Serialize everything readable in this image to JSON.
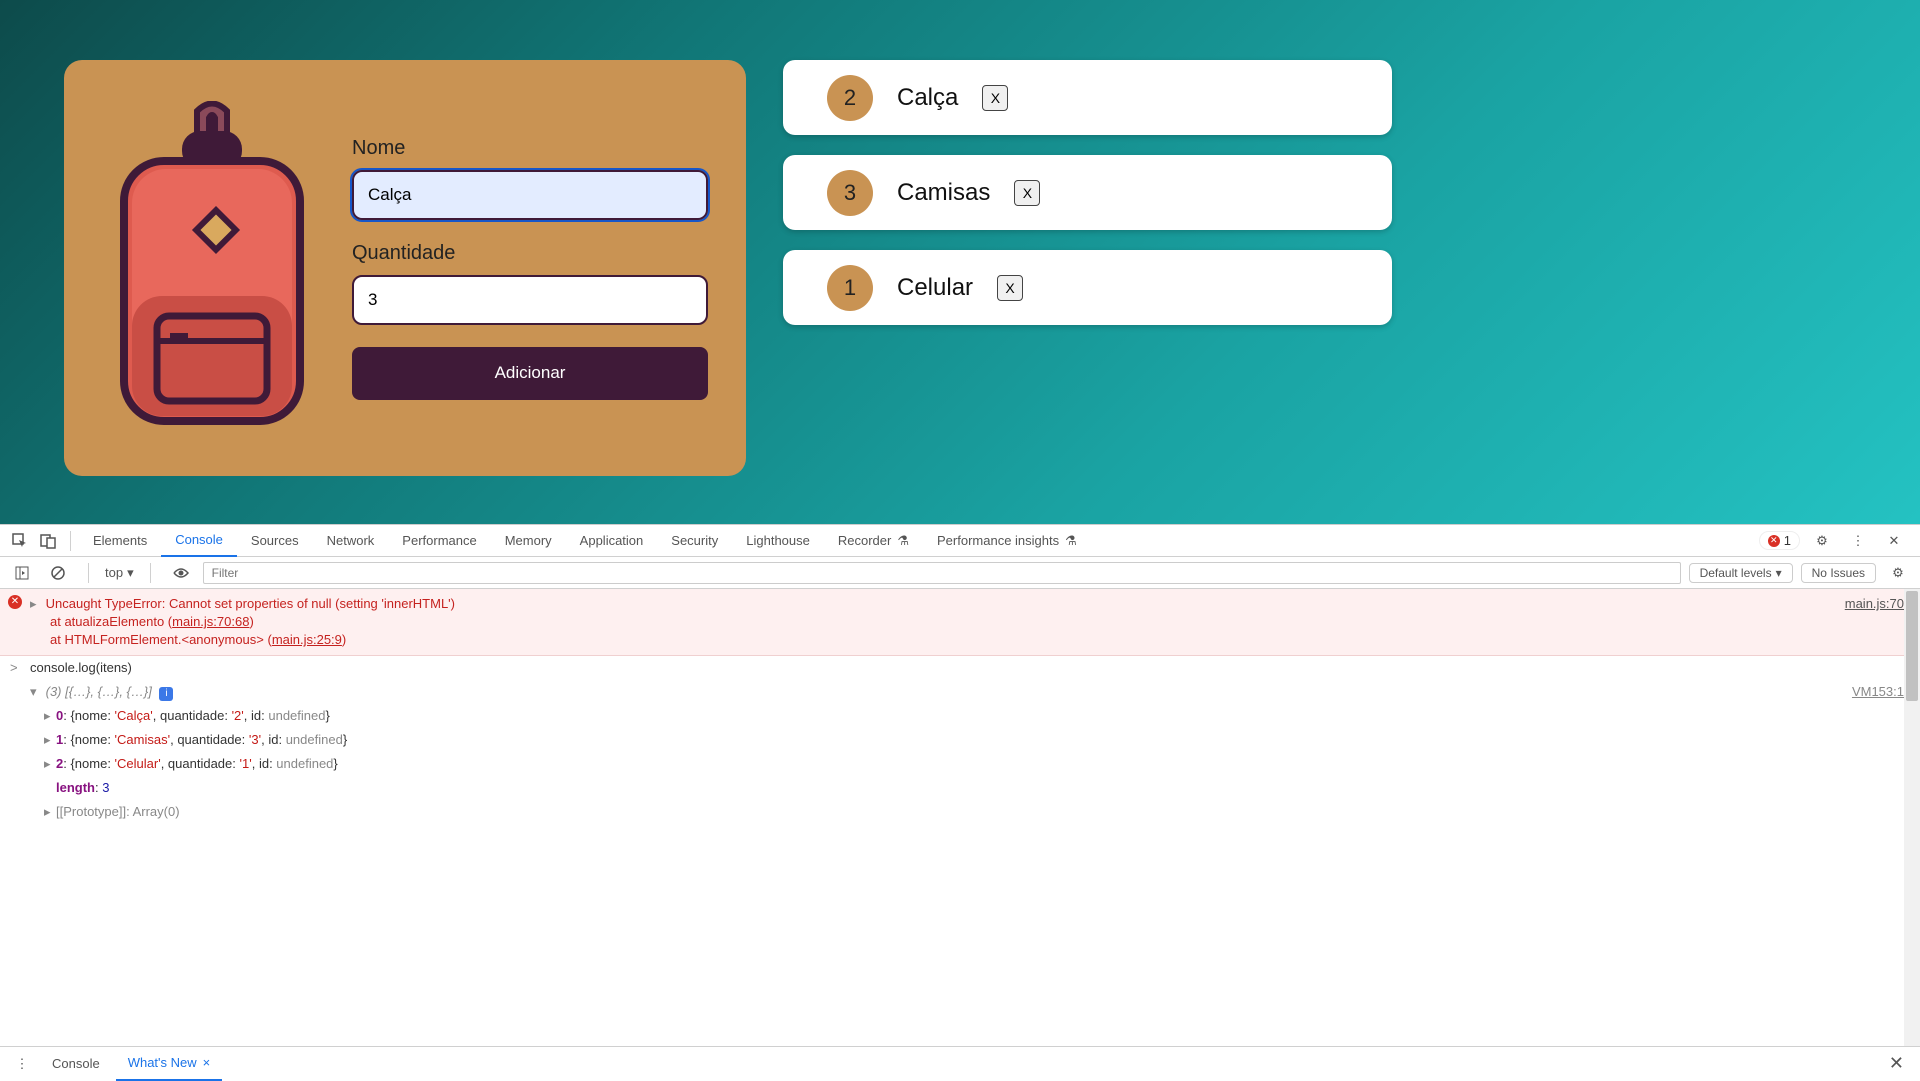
{
  "form": {
    "name_label": "Nome",
    "name_value": "Calça",
    "qty_label": "Quantidade",
    "qty_value": "3",
    "submit_label": "Adicionar"
  },
  "items": [
    {
      "qty": "2",
      "name": "Calça",
      "del": "X"
    },
    {
      "qty": "3",
      "name": "Camisas",
      "del": "X"
    },
    {
      "qty": "1",
      "name": "Celular",
      "del": "X"
    }
  ],
  "devtools": {
    "tabs": [
      "Elements",
      "Console",
      "Sources",
      "Network",
      "Performance",
      "Memory",
      "Application",
      "Security",
      "Lighthouse",
      "Recorder",
      "Performance insights"
    ],
    "active_tab": "Console",
    "error_count": "1",
    "toolbar": {
      "context": "top",
      "filter_placeholder": "Filter",
      "levels": "Default levels",
      "issues": "No Issues"
    },
    "error": {
      "message": "Uncaught TypeError: Cannot set properties of null (setting 'innerHTML')",
      "stack1_prefix": "at atualizaElemento (",
      "stack1_link": "main.js:70:68",
      "stack2_prefix": "at HTMLFormElement.<anonymous> (",
      "stack2_link": "main.js:25:9",
      "source": "main.js:70"
    },
    "console_input": "console.log(itens)",
    "console_src": "VM153:1",
    "array_summary_prefix": "(3)",
    "array_summary_body": " [{…}, {…}, {…}]",
    "entries": [
      {
        "idx": "0",
        "nome": "Calça",
        "quantidade": "2"
      },
      {
        "idx": "1",
        "nome": "Camisas",
        "quantidade": "3"
      },
      {
        "idx": "2",
        "nome": "Celular",
        "quantidade": "1"
      }
    ],
    "length_label": "length",
    "length_value": "3",
    "prototype": "[[Prototype]]: Array(0)",
    "id_label": "id",
    "id_value": "undefined",
    "drawer": {
      "tabs": [
        "Console",
        "What's New"
      ],
      "active": "What's New"
    }
  }
}
